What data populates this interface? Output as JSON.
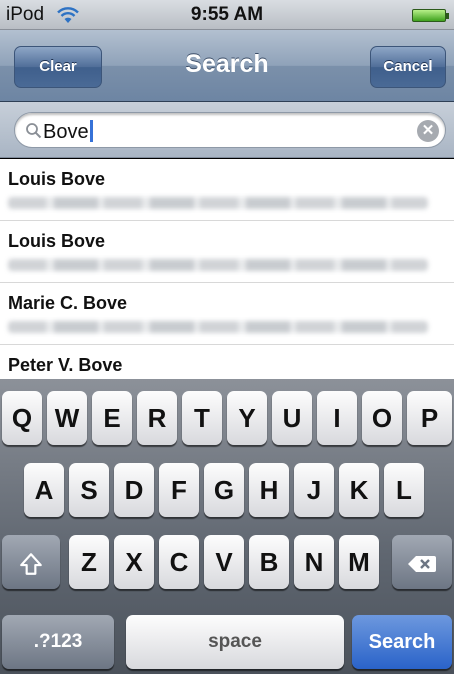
{
  "status": {
    "carrier": "iPod",
    "time": "9:55 AM"
  },
  "nav": {
    "clear_label": "Clear",
    "title": "Search",
    "cancel_label": "Cancel"
  },
  "search": {
    "value": "Bove"
  },
  "results": [
    {
      "name": "Louis Bove"
    },
    {
      "name": "Louis Bove"
    },
    {
      "name": "Marie C. Bove"
    },
    {
      "name": "Peter V. Bove"
    }
  ],
  "keyboard": {
    "row1": [
      "Q",
      "W",
      "E",
      "R",
      "T",
      "Y",
      "U",
      "I",
      "O",
      "P"
    ],
    "row2": [
      "A",
      "S",
      "D",
      "F",
      "G",
      "H",
      "J",
      "K",
      "L"
    ],
    "row3": [
      "Z",
      "X",
      "C",
      "V",
      "B",
      "N",
      "M"
    ],
    "numbers_label": ".?123",
    "space_label": "space",
    "search_label": "Search"
  }
}
